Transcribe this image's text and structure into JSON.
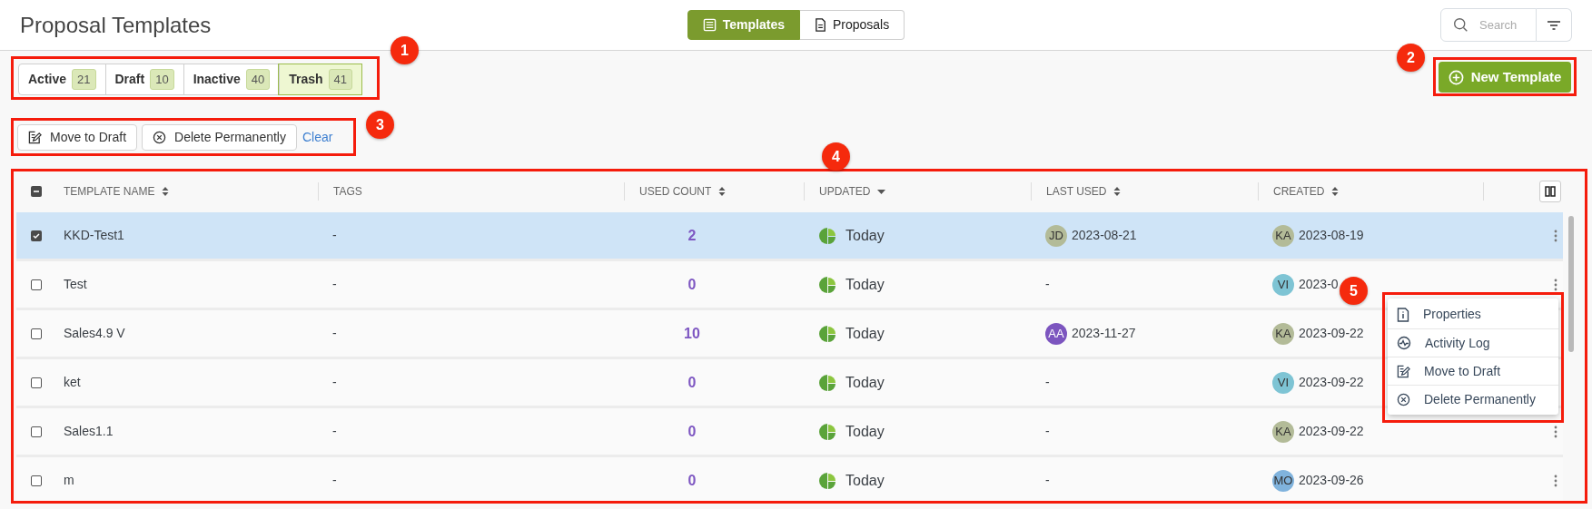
{
  "page_title": "Proposal Templates",
  "view_switch": [
    {
      "label": "Templates",
      "kind": "templates",
      "selected": true
    },
    {
      "label": "Proposals",
      "kind": "proposals",
      "selected": false
    }
  ],
  "search": {
    "placeholder": "Search"
  },
  "status_tabs": [
    {
      "label": "Active",
      "count": "21",
      "selected": false
    },
    {
      "label": "Draft",
      "count": "10",
      "selected": false
    },
    {
      "label": "Inactive",
      "count": "40",
      "selected": false
    },
    {
      "label": "Trash",
      "count": "41",
      "selected": true
    }
  ],
  "new_template_button": "New Template",
  "bulk_actions": [
    {
      "label": "Move to Draft",
      "kind": "draft"
    },
    {
      "label": "Delete Permanently",
      "kind": "delete"
    }
  ],
  "clear_link": "Clear",
  "table": {
    "header_checkbox_indeterminate": true,
    "columns": [
      {
        "label": "TEMPLATE NAME",
        "sortable": true,
        "sorted_desc": false
      },
      {
        "label": "TAGS",
        "sortable": false,
        "sorted_desc": false
      },
      {
        "label": "USED COUNT",
        "sortable": true,
        "sorted_desc": false
      },
      {
        "label": "UPDATED",
        "sortable": true,
        "sorted_desc": true
      },
      {
        "label": "LAST USED",
        "sortable": true,
        "sorted_desc": false
      },
      {
        "label": "CREATED",
        "sortable": true,
        "sorted_desc": false
      }
    ],
    "rows": [
      {
        "selected": true,
        "name": "KKD-Test1",
        "tags": "-",
        "used_count": "2",
        "updated": "Today",
        "last_used": {
          "initials": "JD",
          "color": "#b3bb98",
          "date": "2023-08-21"
        },
        "created": {
          "initials": "KA",
          "color": "#b3bb98",
          "date": "2023-08-19"
        },
        "menu_button": true
      },
      {
        "selected": false,
        "name": "Test",
        "tags": "-",
        "used_count": "0",
        "updated": "Today",
        "last_used": {
          "date": "-"
        },
        "created": {
          "initials": "VI",
          "color": "#7ec4d4",
          "date": "2023-0"
        },
        "menu_button": true
      },
      {
        "selected": false,
        "name": "Sales4.9 V",
        "tags": "-",
        "used_count": "10",
        "updated": "Today",
        "last_used": {
          "initials": "AA",
          "color": "#7c55bf",
          "date": "2023-11-27"
        },
        "created": {
          "initials": "KA",
          "color": "#b3bb98",
          "date": "2023-09-22"
        },
        "menu_button": false
      },
      {
        "selected": false,
        "name": "ket",
        "tags": "-",
        "used_count": "0",
        "updated": "Today",
        "last_used": {
          "date": "-"
        },
        "created": {
          "initials": "VI",
          "color": "#7ec4d4",
          "date": "2023-09-22"
        },
        "menu_button": false
      },
      {
        "selected": false,
        "name": "Sales1.1",
        "tags": "-",
        "used_count": "0",
        "updated": "Today",
        "last_used": {
          "date": "-"
        },
        "created": {
          "initials": "KA",
          "color": "#b3bb98",
          "date": "2023-09-22"
        },
        "menu_button": true
      },
      {
        "selected": false,
        "name": "m",
        "tags": "-",
        "used_count": "0",
        "updated": "Today",
        "last_used": {
          "date": "-"
        },
        "created": {
          "initials": "MO",
          "color": "#80b3dd",
          "date": "2023-09-26"
        },
        "menu_button": true
      }
    ]
  },
  "context_menu": [
    {
      "label": "Properties",
      "kind": "properties"
    },
    {
      "label": "Activity Log",
      "kind": "activity"
    },
    {
      "label": "Move to Draft",
      "kind": "draft"
    },
    {
      "label": "Delete Permanently",
      "kind": "delete"
    }
  ],
  "annotations": [
    {
      "number": "1"
    },
    {
      "number": "2"
    },
    {
      "number": "3"
    },
    {
      "number": "4"
    },
    {
      "number": "5"
    }
  ]
}
